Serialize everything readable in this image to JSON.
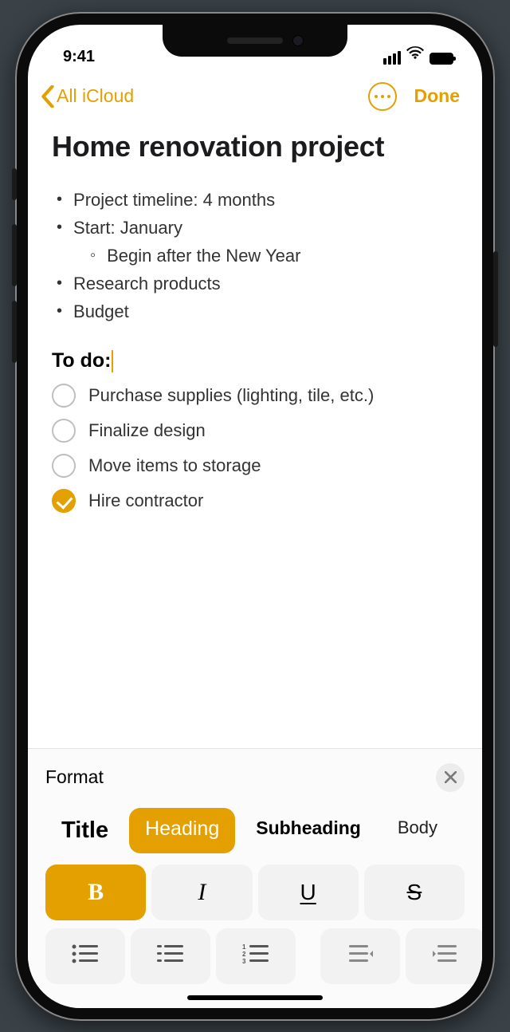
{
  "statusBar": {
    "time": "9:41"
  },
  "nav": {
    "back": "All iCloud",
    "done": "Done"
  },
  "note": {
    "title": "Home renovation project",
    "bullets": [
      {
        "text": "Project timeline: 4 months",
        "level": 0
      },
      {
        "text": "Start: January",
        "level": 0
      },
      {
        "text": "Begin after the New Year",
        "level": 1
      },
      {
        "text": "Research products",
        "level": 0
      },
      {
        "text": "Budget",
        "level": 0
      }
    ],
    "subheading": "To do:",
    "checklist": [
      {
        "text": "Purchase supplies (lighting, tile, etc.)",
        "checked": false
      },
      {
        "text": "Finalize design",
        "checked": false
      },
      {
        "text": "Move items to storage",
        "checked": false
      },
      {
        "text": "Hire contractor",
        "checked": true
      }
    ]
  },
  "format": {
    "panelTitle": "Format",
    "styles": {
      "title": "Title",
      "heading": "Heading",
      "subheading": "Subheading",
      "body": "Body",
      "active": "heading"
    },
    "emphasis": {
      "bold": "B",
      "italic": "I",
      "underline": "U",
      "strike": "S",
      "boldActive": true
    }
  }
}
